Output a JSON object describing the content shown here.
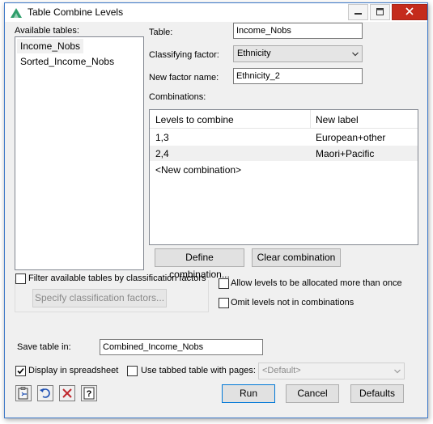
{
  "window": {
    "title": "Table Combine Levels",
    "minimize_icon": "minimize-icon",
    "maximize_icon": "maximize-icon",
    "close_icon": "close-icon",
    "app_icon": "genstat-triangle-icon"
  },
  "available_tables": {
    "label": "Available tables:",
    "items": [
      "Income_Nobs",
      "Sorted_Income_Nobs"
    ],
    "selected_index": 0
  },
  "table": {
    "label": "Table:",
    "value": "Income_Nobs"
  },
  "classifying_factor": {
    "label": "Classifying factor:",
    "value": "Ethnicity"
  },
  "new_factor_name": {
    "label": "New factor name:",
    "value": "Ethnicity_2"
  },
  "combinations": {
    "label": "Combinations:",
    "columns": [
      "Levels to combine",
      "New label"
    ],
    "rows": [
      {
        "levels": "1,3",
        "new_label": "European+other"
      },
      {
        "levels": "2,4",
        "new_label": "Maori+Pacific"
      }
    ],
    "new_row": "<New combination>",
    "highlight_row_index": 1
  },
  "buttons": {
    "define_combination": "Define combination...",
    "clear_combination": "Clear combination",
    "specify_classification": "Specify classification factors...",
    "run": "Run",
    "cancel": "Cancel",
    "defaults": "Defaults"
  },
  "options": {
    "filter_tables": {
      "label": "Filter available tables by classification factors",
      "checked": false
    },
    "allow_multiple": {
      "label": "Allow levels to be allocated more than once",
      "checked": false
    },
    "omit_levels": {
      "label": "Omit levels not in combinations",
      "checked": false
    },
    "display_spreadsheet": {
      "label": "Display in spreadsheet",
      "checked": true
    },
    "tabbed_table": {
      "label": "Use tabbed table with pages:",
      "checked": false
    }
  },
  "save_table": {
    "label": "Save table in:",
    "value": "Combined_Income_Nobs"
  },
  "pages_select": {
    "value": "<Default>"
  },
  "bottom_icons": [
    "clipboard-icon",
    "undo-icon",
    "clear-icon",
    "help-icon"
  ],
  "colors": {
    "accent": "#0078d7",
    "row_highlight": "#f0f0f0",
    "close_red": "#c42b1c"
  }
}
